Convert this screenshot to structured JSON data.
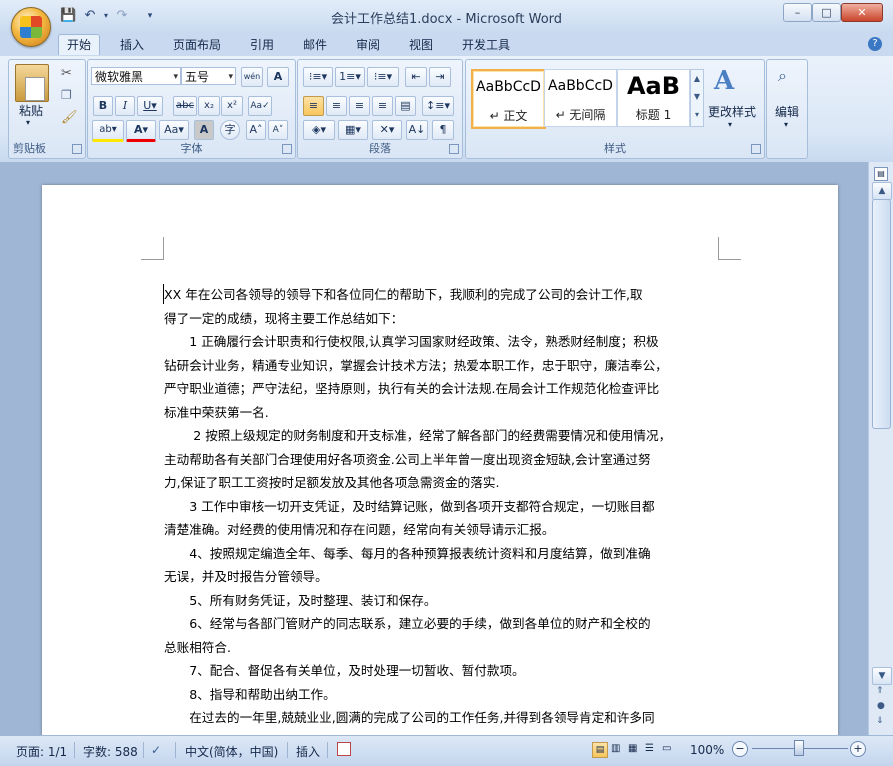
{
  "window": {
    "title": "会计工作总结1.docx - Microsoft Word",
    "minimize": "–",
    "maximize": "□",
    "close": "✕"
  },
  "tabs": [
    {
      "label": "开始",
      "active": true
    },
    {
      "label": "插入"
    },
    {
      "label": "页面布局"
    },
    {
      "label": "引用"
    },
    {
      "label": "邮件"
    },
    {
      "label": "审阅"
    },
    {
      "label": "视图"
    },
    {
      "label": "开发工具"
    }
  ],
  "ribbon": {
    "clipboard": {
      "label": "剪贴板",
      "paste": "粘贴"
    },
    "font": {
      "label": "字体",
      "font_name": "微软雅黑",
      "font_size": "五号"
    },
    "paragraph": {
      "label": "段落"
    },
    "styles": {
      "label": "样式",
      "items": [
        {
          "sample": "AaBbCcD",
          "name": "↵ 正文"
        },
        {
          "sample": "AaBbCcD",
          "name": "↵ 无间隔"
        },
        {
          "sample": "AaB",
          "name": "标题 1"
        }
      ],
      "change_styles": "更改样式"
    },
    "editing": {
      "label": "编辑"
    }
  },
  "document": {
    "paragraphs": [
      "XX 年在公司各领导的领导下和各位同仁的帮助下，我顺利的完成了公司的会计工作,取",
      "得了一定的成绩，现将主要工作总结如下：",
      "　　1 正确履行会计职责和行使权限,认真学习国家财经政策、法令，熟悉财经制度；积极",
      "钻研会计业务，精通专业知识，掌握会计技术方法；热爱本职工作，忠于职守，廉洁奉公，",
      "严守职业道德；严守法纪，坚持原则，执行有关的会计法规.在局会计工作规范化检查评比",
      "标准中荣获第一名.",
      "　　 2  按照上级规定的财务制度和开支标准，经常了解各部门的经费需要情况和使用情况，",
      "主动帮助各有关部门合理使用好各项资金.公司上半年曾一度出现资金短缺,会计室通过努",
      "力,保证了职工工资按时足额发放及其他各项急需资金的落实.",
      "　　3 工作中审核一切开支凭证，及时结算记账，做到各项开支都符合规定，一切账目都",
      "清楚准确。对经费的使用情况和存在问题，经常向有关领导请示汇报。",
      "　　4、按照规定编造全年、每季、每月的各种预算报表统计资料和月度结算，做到准确",
      "无误，并及时报告分管领导。",
      "　　5、所有财务凭证，及时整理、装订和保存。",
      "　　6、经常与各部门管财产的同志联系，建立必要的手续，做到各单位的财产和全校的",
      "总账相符合.",
      "　　7、配合、督促各有关单位，及时处理一切暂收、暂付款项。",
      "　　8、指导和帮助出纳工作。",
      "　　在过去的一年里,兢兢业业,圆满的完成了公司的工作任务,并得到各领导肯定和许多同"
    ]
  },
  "status": {
    "page": "页面: 1/1",
    "words": "字数: 588",
    "language": "中文(简体，中国)",
    "insert": "插入",
    "zoom": "100%"
  }
}
